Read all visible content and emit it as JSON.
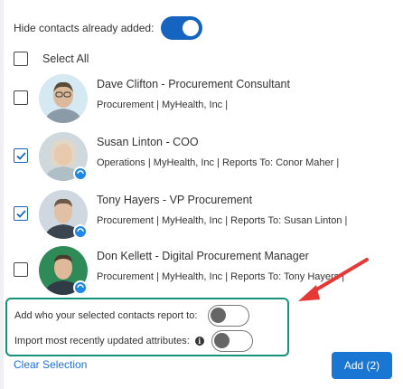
{
  "header": {
    "hide_label": "Hide contacts already added:",
    "hide_enabled": true
  },
  "select_all": {
    "label": "Select All",
    "checked": false
  },
  "contacts": [
    {
      "name": "Dave Clifton  - Procurement Consultant",
      "details": "Procurement | MyHealth, Inc |",
      "checked": false,
      "has_badge": false
    },
    {
      "name": "Susan Linton  - COO",
      "details": "Operations | MyHealth, Inc | Reports To: Conor Maher |",
      "checked": true,
      "has_badge": true
    },
    {
      "name": "Tony Hayers  - VP Procurement",
      "details": "Procurement | MyHealth, Inc | Reports To: Susan Linton |",
      "checked": true,
      "has_badge": true
    },
    {
      "name": "Don Kellett  - Digital Procurement Manager",
      "details": "Procurement | MyHealth, Inc | Reports To: Tony Hayers |",
      "checked": false,
      "has_badge": true
    }
  ],
  "options": {
    "report_to_label": "Add who your selected contacts report to:",
    "report_to_enabled": false,
    "import_label": "Import most recently updated attributes:",
    "import_enabled": false
  },
  "footer": {
    "clear_label": "Clear Selection",
    "add_label": "Add (2)"
  },
  "colors": {
    "accent": "#1565c0",
    "highlight_border": "#16917a",
    "arrow": "#e53935",
    "link": "#1e6fd9"
  }
}
